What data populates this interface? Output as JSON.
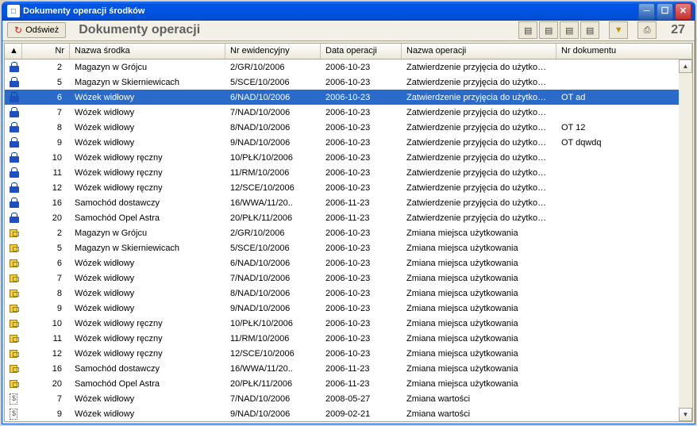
{
  "window": {
    "title": "Dokumenty operacji środków"
  },
  "toolbar": {
    "refresh_label": "Odśwież",
    "section_title": "Dokumenty  operacji",
    "count": "27"
  },
  "columns": {
    "indicator": "▲",
    "nr": "Nr",
    "name": "Nazwa środka",
    "ev": "Nr ewidencyjny",
    "date": "Data operacji",
    "op": "Nazwa operacji",
    "doc": "Nr dokumentu"
  },
  "rows": [
    {
      "icon": "lock",
      "nr": "2",
      "name": "Magazyn w Grójcu",
      "ev": "2/GR/10/2006",
      "date": "2006-10-23",
      "op": "Zatwierdzenie przyjęcia do użytkowa..",
      "doc": ""
    },
    {
      "icon": "lock",
      "nr": "5",
      "name": "Magazyn w Skierniewicach",
      "ev": "5/SCE/10/2006",
      "date": "2006-10-23",
      "op": "Zatwierdzenie przyjęcia do użytkowa..",
      "doc": ""
    },
    {
      "icon": "lock",
      "nr": "6",
      "name": "Wózek widłowy",
      "ev": "6/NAD/10/2006",
      "date": "2006-10-23",
      "op": "Zatwierdzenie przyjęcia do użytkowa..",
      "doc": "OT ad",
      "selected": true
    },
    {
      "icon": "lock",
      "nr": "7",
      "name": "Wózek widłowy",
      "ev": "7/NAD/10/2006",
      "date": "2006-10-23",
      "op": "Zatwierdzenie przyjęcia do użytkowa..",
      "doc": ""
    },
    {
      "icon": "lock",
      "nr": "8",
      "name": "Wózek widłowy",
      "ev": "8/NAD/10/2006",
      "date": "2006-10-23",
      "op": "Zatwierdzenie przyjęcia do użytkowa..",
      "doc": "OT 12"
    },
    {
      "icon": "lock",
      "nr": "9",
      "name": "Wózek widłowy",
      "ev": "9/NAD/10/2006",
      "date": "2006-10-23",
      "op": "Zatwierdzenie przyjęcia do użytkowa..",
      "doc": "OT dqwdq"
    },
    {
      "icon": "lock",
      "nr": "10",
      "name": "Wózek widłowy ręczny",
      "ev": "10/PŁK/10/2006",
      "date": "2006-10-23",
      "op": "Zatwierdzenie przyjęcia do użytkowa..",
      "doc": ""
    },
    {
      "icon": "lock",
      "nr": "11",
      "name": "Wózek widłowy ręczny",
      "ev": "11/RM/10/2006",
      "date": "2006-10-23",
      "op": "Zatwierdzenie przyjęcia do użytkowa..",
      "doc": ""
    },
    {
      "icon": "lock",
      "nr": "12",
      "name": "Wózek widłowy ręczny",
      "ev": "12/SCE/10/2006",
      "date": "2006-10-23",
      "op": "Zatwierdzenie przyjęcia do użytkowa..",
      "doc": ""
    },
    {
      "icon": "lock",
      "nr": "16",
      "name": "Samochód dostawczy",
      "ev": "16/WWA/11/20..",
      "date": "2006-11-23",
      "op": "Zatwierdzenie przyjęcia do użytkowa..",
      "doc": ""
    },
    {
      "icon": "lock",
      "nr": "20",
      "name": "Samochód Opel Astra",
      "ev": "20/PŁK/11/2006",
      "date": "2006-11-23",
      "op": "Zatwierdzenie przyjęcia do użytkowa..",
      "doc": ""
    },
    {
      "icon": "move",
      "nr": "2",
      "name": "Magazyn w Grójcu",
      "ev": "2/GR/10/2006",
      "date": "2006-10-23",
      "op": "Zmiana miejsca użytkowania",
      "doc": ""
    },
    {
      "icon": "move",
      "nr": "5",
      "name": "Magazyn w Skierniewicach",
      "ev": "5/SCE/10/2006",
      "date": "2006-10-23",
      "op": "Zmiana miejsca użytkowania",
      "doc": ""
    },
    {
      "icon": "move",
      "nr": "6",
      "name": "Wózek widłowy",
      "ev": "6/NAD/10/2006",
      "date": "2006-10-23",
      "op": "Zmiana miejsca użytkowania",
      "doc": ""
    },
    {
      "icon": "move",
      "nr": "7",
      "name": "Wózek widłowy",
      "ev": "7/NAD/10/2006",
      "date": "2006-10-23",
      "op": "Zmiana miejsca użytkowania",
      "doc": ""
    },
    {
      "icon": "move",
      "nr": "8",
      "name": "Wózek widłowy",
      "ev": "8/NAD/10/2006",
      "date": "2006-10-23",
      "op": "Zmiana miejsca użytkowania",
      "doc": ""
    },
    {
      "icon": "move",
      "nr": "9",
      "name": "Wózek widłowy",
      "ev": "9/NAD/10/2006",
      "date": "2006-10-23",
      "op": "Zmiana miejsca użytkowania",
      "doc": ""
    },
    {
      "icon": "move",
      "nr": "10",
      "name": "Wózek widłowy ręczny",
      "ev": "10/PŁK/10/2006",
      "date": "2006-10-23",
      "op": "Zmiana miejsca użytkowania",
      "doc": ""
    },
    {
      "icon": "move",
      "nr": "11",
      "name": "Wózek widłowy ręczny",
      "ev": "11/RM/10/2006",
      "date": "2006-10-23",
      "op": "Zmiana miejsca użytkowania",
      "doc": ""
    },
    {
      "icon": "move",
      "nr": "12",
      "name": "Wózek widłowy ręczny",
      "ev": "12/SCE/10/2006",
      "date": "2006-10-23",
      "op": "Zmiana miejsca użytkowania",
      "doc": ""
    },
    {
      "icon": "move",
      "nr": "16",
      "name": "Samochód dostawczy",
      "ev": "16/WWA/11/20..",
      "date": "2006-11-23",
      "op": "Zmiana miejsca użytkowania",
      "doc": ""
    },
    {
      "icon": "move",
      "nr": "20",
      "name": "Samochód Opel Astra",
      "ev": "20/PŁK/11/2006",
      "date": "2006-11-23",
      "op": "Zmiana miejsca użytkowania",
      "doc": ""
    },
    {
      "icon": "value",
      "nr": "7",
      "name": "Wózek widłowy",
      "ev": "7/NAD/10/2006",
      "date": "2008-05-27",
      "op": "Zmiana wartości",
      "doc": ""
    },
    {
      "icon": "value",
      "nr": "9",
      "name": "Wózek widłowy",
      "ev": "9/NAD/10/2006",
      "date": "2009-02-21",
      "op": "Zmiana wartości",
      "doc": ""
    }
  ]
}
